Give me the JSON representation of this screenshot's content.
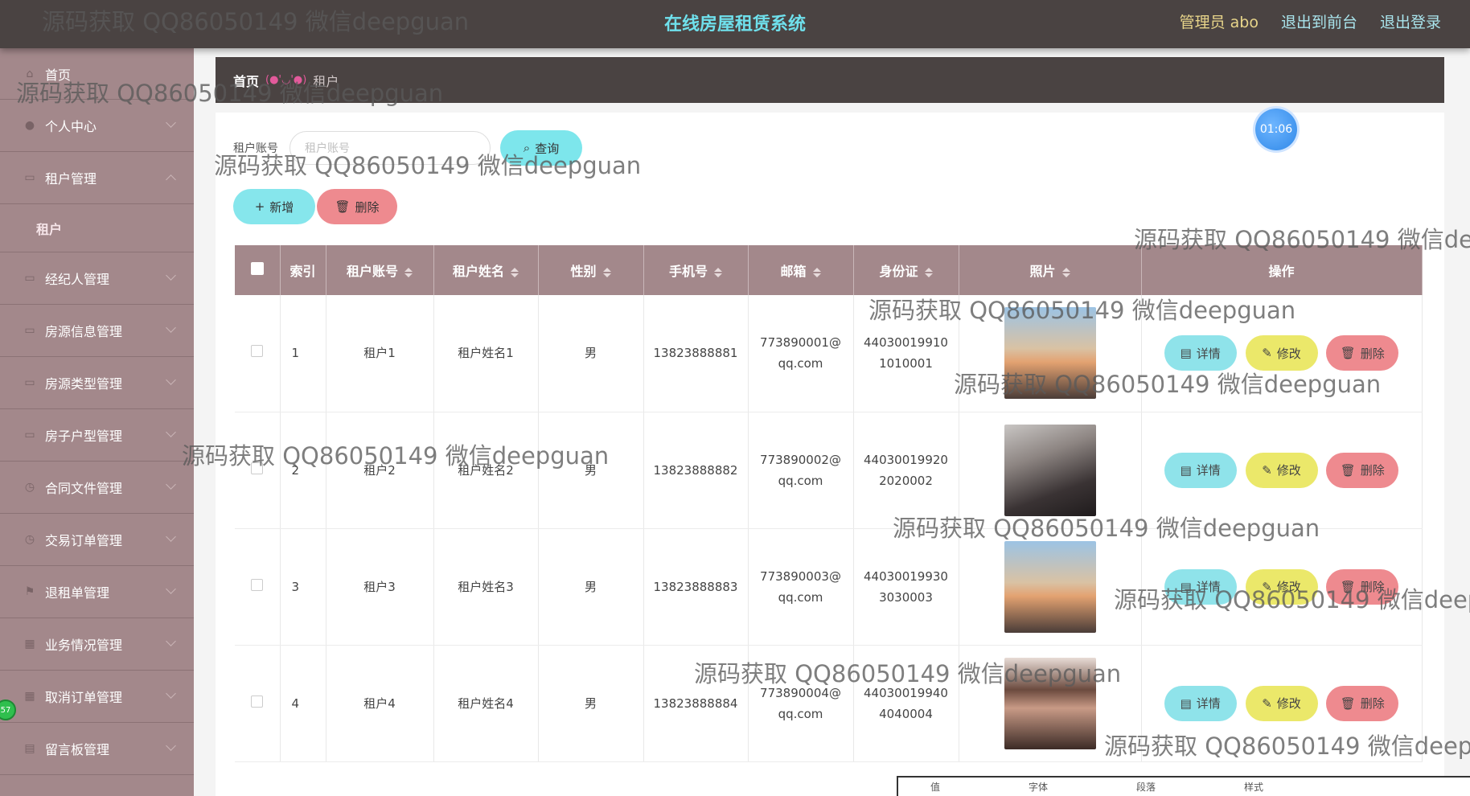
{
  "header": {
    "title": "在线房屋租赁系统",
    "admin": "管理员 abo",
    "front": "退出到前台",
    "logout": "退出登录"
  },
  "sidebar": {
    "items": [
      {
        "label": "首页",
        "icon": "home-icon"
      },
      {
        "label": "个人中心",
        "icon": "user-icon"
      },
      {
        "label": "租户管理",
        "icon": "folder-icon",
        "expanded": true,
        "sub": "租户"
      },
      {
        "label": "经纪人管理",
        "icon": "folder-icon"
      },
      {
        "label": "房源信息管理",
        "icon": "folder-icon"
      },
      {
        "label": "房源类型管理",
        "icon": "folder-icon"
      },
      {
        "label": "房子户型管理",
        "icon": "folder-icon"
      },
      {
        "label": "合同文件管理",
        "icon": "clock-icon"
      },
      {
        "label": "交易订单管理",
        "icon": "clock-icon"
      },
      {
        "label": "退租单管理",
        "icon": "flag-icon"
      },
      {
        "label": "业务情况管理",
        "icon": "grid-icon"
      },
      {
        "label": "取消订单管理",
        "icon": "grid-icon"
      },
      {
        "label": "留言板管理",
        "icon": "message-icon"
      }
    ],
    "badge": "57"
  },
  "breadcrumb": {
    "home": "首页",
    "separator": "(●'◡'●)",
    "current": "租户"
  },
  "search": {
    "label": "租户账号",
    "placeholder": "租户账号",
    "query": "查询"
  },
  "actions": {
    "add": "新增",
    "delete": "删除"
  },
  "timer": "01:06",
  "table": {
    "columns": [
      "索引",
      "租户账号",
      "租户姓名",
      "性别",
      "手机号",
      "邮箱",
      "身份证",
      "照片",
      "操作"
    ],
    "row_actions": {
      "detail": "详情",
      "edit": "修改",
      "delete": "删除"
    },
    "rows": [
      {
        "index": "1",
        "account": "租户1",
        "name": "租户姓名1",
        "gender": "男",
        "phone": "13823888881",
        "email_a": "773890001@",
        "email_b": "qq.com",
        "id_a": "44030019910",
        "id_b": "1010001",
        "photo": "man-portrait-sunset"
      },
      {
        "index": "2",
        "account": "租户2",
        "name": "租户姓名2",
        "gender": "男",
        "phone": "13823888882",
        "email_a": "773890002@",
        "email_b": "qq.com",
        "id_a": "44030019920",
        "id_b": "2020002",
        "photo": "man-portrait-dark"
      },
      {
        "index": "3",
        "account": "租户3",
        "name": "租户姓名3",
        "gender": "男",
        "phone": "13823888883",
        "email_a": "773890003@",
        "email_b": "qq.com",
        "id_a": "44030019930",
        "id_b": "3030003",
        "photo": "man-portrait-sunset"
      },
      {
        "index": "4",
        "account": "租户4",
        "name": "租户姓名4",
        "gender": "男",
        "phone": "13823888884",
        "email_a": "773890004@",
        "email_b": "qq.com",
        "id_a": "44030019940",
        "id_b": "4040004",
        "photo": "woman-portrait"
      }
    ]
  },
  "watermark": "源码获取 QQ86050149 微信deepguan",
  "taskbar": [
    "值",
    "字体",
    "段落",
    "样式"
  ]
}
